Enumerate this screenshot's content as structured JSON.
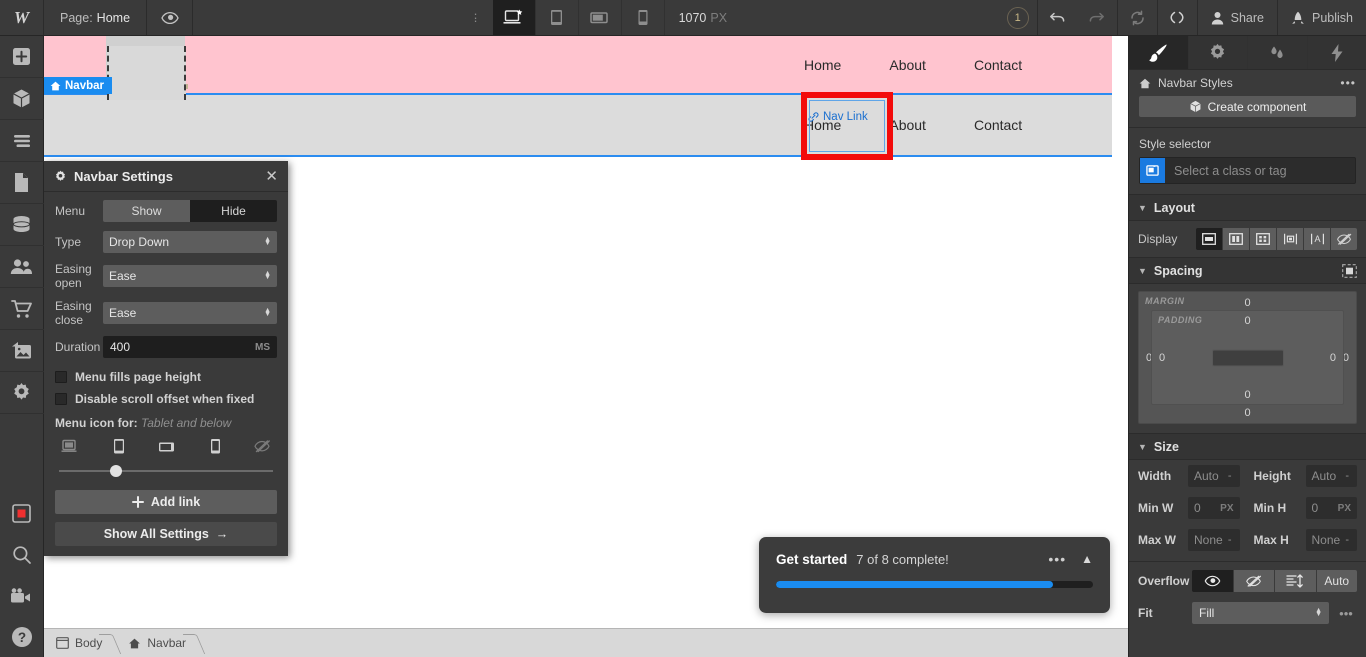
{
  "topbar": {
    "logo": "W",
    "page_prefix": "Page:",
    "page_name": "Home",
    "eye_icon": "eye-icon",
    "more_icon": "vertical-dots-icon",
    "breakpoints": [
      {
        "name": "desktop-breakpoint",
        "icon": "desktop-star-icon",
        "active": true
      },
      {
        "name": "tablet-breakpoint",
        "icon": "tablet-icon",
        "active": false
      },
      {
        "name": "mobile-landscape-breakpoint",
        "icon": "mobile-landscape-icon",
        "active": false
      },
      {
        "name": "mobile-portrait-breakpoint",
        "icon": "mobile-portrait-icon",
        "active": false
      }
    ],
    "viewport_value": "1070",
    "viewport_unit": "PX",
    "notification_count": "1",
    "undo_icon": "undo-icon",
    "redo_icon": "redo-icon",
    "sync_icon": "sync-icon",
    "code_icon": "code-brackets-icon",
    "share_label": "Share",
    "publish_label": "Publish"
  },
  "rail": {
    "items": [
      {
        "name": "add-elements",
        "icon": "plus-icon"
      },
      {
        "name": "components",
        "icon": "cube-icon"
      },
      {
        "name": "navigator",
        "icon": "layers-icon"
      },
      {
        "name": "pages",
        "icon": "page-icon"
      },
      {
        "name": "cms",
        "icon": "database-icon"
      },
      {
        "name": "users",
        "icon": "people-icon"
      },
      {
        "name": "ecommerce",
        "icon": "cart-icon"
      },
      {
        "name": "assets",
        "icon": "image-icon"
      },
      {
        "name": "settings",
        "icon": "gear-icon"
      },
      {
        "name": "components-panel",
        "icon": "red-square-icon"
      },
      {
        "name": "search",
        "icon": "magnifier-icon"
      },
      {
        "name": "video-tutorials",
        "icon": "video-camera-icon"
      },
      {
        "name": "help",
        "icon": "question-circle-icon"
      }
    ]
  },
  "canvas": {
    "navbar_tag": "Navbar",
    "navbar_tag_icon": "home-icon",
    "navlink_tag": "Nav Link",
    "navlink_tag_icon": "link-icon",
    "pink_links": [
      "Home",
      "About",
      "Contact"
    ],
    "grey_links": [
      "Home",
      "About",
      "Contact"
    ],
    "colors": {
      "pink_band": "#ffc4cf",
      "grey_nav": "#dcdcdc",
      "selection_blue": "#2b8cf0",
      "highlight_red": "#f30b0b",
      "tag_blue": "#1a8cf0"
    }
  },
  "navbar_settings": {
    "title": "Navbar Settings",
    "gear_icon": "gear-icon",
    "close_icon": "close-icon",
    "menu_label": "Menu",
    "menu_show": "Show",
    "menu_hide": "Hide",
    "menu_selected": "Show",
    "type_label": "Type",
    "type_value": "Drop Down",
    "easing_open_label": "Easing open",
    "easing_open_value": "Ease",
    "easing_close_label": "Easing close",
    "easing_close_value": "Ease",
    "duration_label": "Duration",
    "duration_value": "400",
    "duration_unit": "MS",
    "checkbox_fills_height": "Menu fills page height",
    "checkbox_fills_height_checked": false,
    "checkbox_disable_scroll": "Disable scroll offset when fixed",
    "checkbox_disable_scroll_checked": false,
    "menu_icon_for_label": "Menu icon for:",
    "menu_icon_for_value": "Tablet and below",
    "device_icons": [
      {
        "name": "desktop-device-icon",
        "dim": true
      },
      {
        "name": "tablet-device-icon",
        "dim": false
      },
      {
        "name": "mobile-landscape-device-icon",
        "dim": false
      },
      {
        "name": "mobile-portrait-device-icon",
        "dim": false
      },
      {
        "name": "hidden-eye-device-icon",
        "dim": true
      }
    ],
    "slider_position_pct": 24,
    "add_link_label": "Add link",
    "add_link_icon": "plus-icon",
    "show_all_settings_label": "Show All Settings",
    "show_all_settings_icon": "arrow-right-icon"
  },
  "right_panel": {
    "tabs": [
      {
        "name": "tab-style",
        "icon": "paintbrush-icon",
        "active": true
      },
      {
        "name": "tab-settings",
        "icon": "gear-icon",
        "active": false
      },
      {
        "name": "tab-interactions",
        "icon": "droplets-icon",
        "active": false
      },
      {
        "name": "tab-effects",
        "icon": "lightning-icon",
        "active": false
      }
    ],
    "subtitle": "Navbar Styles",
    "subtitle_icon": "home-icon",
    "subtitle_more_icon": "horizontal-dots-icon",
    "create_component_label": "Create component",
    "create_component_icon": "cube-icon",
    "style_selector_label": "Style selector",
    "style_selector_placeholder": "Select a class or tag",
    "style_selector_icon": "element-icon",
    "layout": {
      "title": "Layout",
      "display_label": "Display",
      "display_options": [
        {
          "name": "display-block",
          "icon": "block-icon",
          "active": true
        },
        {
          "name": "display-flex",
          "icon": "flex-icon",
          "active": false
        },
        {
          "name": "display-grid",
          "icon": "grid-icon",
          "active": false
        },
        {
          "name": "display-inline-block",
          "icon": "inline-block-icon",
          "active": false
        },
        {
          "name": "display-inline",
          "icon": "inline-text-icon",
          "active": false
        },
        {
          "name": "display-none",
          "icon": "none-eye-icon",
          "active": false
        }
      ]
    },
    "spacing": {
      "title": "Spacing",
      "toggle_icon": "spacing-mode-icon",
      "margin_label": "MARGIN",
      "padding_label": "PADDING",
      "margin": {
        "top": "0",
        "right": "0",
        "bottom": "0",
        "left": "0"
      },
      "padding": {
        "top": "0",
        "right": "0",
        "bottom": "0",
        "left": "0"
      }
    },
    "size": {
      "title": "Size",
      "width_label": "Width",
      "width_value": "Auto",
      "height_label": "Height",
      "height_value": "Auto",
      "minw_label": "Min W",
      "minw_value": "0",
      "minw_unit": "PX",
      "minh_label": "Min H",
      "minh_value": "0",
      "minh_unit": "PX",
      "maxw_label": "Max W",
      "maxw_value": "None",
      "maxh_label": "Max H",
      "maxh_value": "None",
      "overflow_label": "Overflow",
      "overflow_options": [
        {
          "name": "overflow-visible",
          "icon": "eye-icon",
          "active": true
        },
        {
          "name": "overflow-hidden",
          "icon": "eye-slash-icon",
          "active": false
        },
        {
          "name": "overflow-scroll",
          "icon": "scroll-icon",
          "active": false
        },
        {
          "name": "overflow-auto",
          "label": "Auto",
          "active": false
        }
      ],
      "fit_label": "Fit",
      "fit_value": "Fill",
      "fit_more_icon": "horizontal-dots-icon"
    }
  },
  "get_started": {
    "title": "Get started",
    "subtitle": "7 of 8 complete!",
    "more_icon": "horizontal-dots-icon",
    "collapse_icon": "chevron-up-icon",
    "progress_pct": 87.5,
    "progress_color": "#1a8cf0"
  },
  "bottom_bar": {
    "crumbs": [
      {
        "label": "Body",
        "icon": "body-icon"
      },
      {
        "label": "Navbar",
        "icon": "home-icon"
      }
    ]
  }
}
